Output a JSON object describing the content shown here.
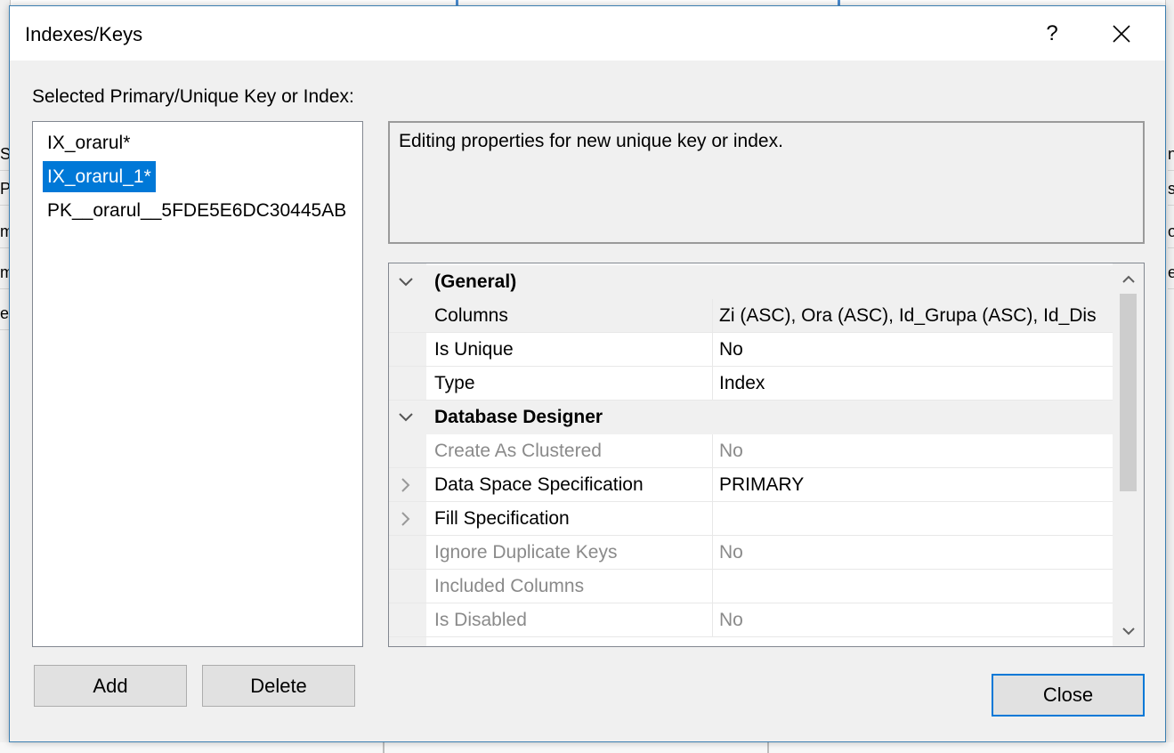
{
  "dialog": {
    "title": "Indexes/Keys",
    "help_label": "?",
    "section_label": "Selected Primary/Unique Key or Index:",
    "description": "Editing properties for new unique key or index."
  },
  "keys": [
    {
      "label": "IX_orarul*",
      "selected": false
    },
    {
      "label": "IX_orarul_1*",
      "selected": true
    },
    {
      "label": "PK__orarul__5FDE5E6DC30445AB",
      "selected": false
    }
  ],
  "properties": [
    {
      "name": "(General)",
      "value": "",
      "category": true,
      "expander": "chevron-down"
    },
    {
      "name": "Columns",
      "value": "Zi (ASC), Ora (ASC), Id_Grupa (ASC), Id_Dis",
      "category": false,
      "disabled": false
    },
    {
      "name": "Is Unique",
      "value": "No",
      "category": false,
      "disabled": false
    },
    {
      "name": "Type",
      "value": "Index",
      "category": false,
      "disabled": false
    },
    {
      "name": "Database Designer",
      "value": "",
      "category": true,
      "expander": "chevron-down"
    },
    {
      "name": "Create As Clustered",
      "value": "No",
      "category": false,
      "disabled": true
    },
    {
      "name": "Data Space Specification",
      "value": "PRIMARY",
      "category": false,
      "disabled": false,
      "expander": "chevron-right"
    },
    {
      "name": "Fill Specification",
      "value": "",
      "category": false,
      "disabled": false,
      "expander": "chevron-right"
    },
    {
      "name": "Ignore Duplicate Keys",
      "value": "No",
      "category": false,
      "disabled": true
    },
    {
      "name": "Included Columns",
      "value": "",
      "category": false,
      "disabled": true
    },
    {
      "name": "Is Disabled",
      "value": "No",
      "category": false,
      "disabled": true
    }
  ],
  "buttons": {
    "add": "Add",
    "delete": "Delete",
    "close": "Close"
  },
  "background": {
    "left_fragments": [
      "S",
      "Pr",
      "m",
      "m",
      "e"
    ],
    "right_fragments": [
      "n",
      "se",
      "o",
      "e"
    ]
  },
  "colors": {
    "selection": "#0078d7",
    "dialog_border": "#3c7fb1",
    "disabled_text": "#8a8a8a"
  }
}
